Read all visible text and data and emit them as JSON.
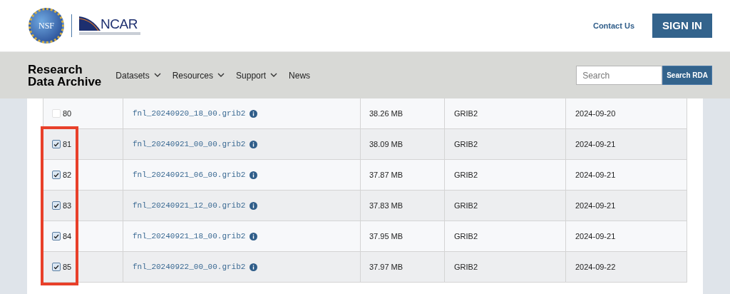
{
  "header": {
    "logos": {
      "nsf": "NSF",
      "ncar": "NCAR"
    },
    "contact": "Contact Us",
    "sign_in": "SIGN IN"
  },
  "nav": {
    "title_lines": [
      "Research",
      "Data Archive"
    ],
    "items": [
      {
        "label": "Datasets",
        "dropdown": true
      },
      {
        "label": "Resources",
        "dropdown": true
      },
      {
        "label": "Support",
        "dropdown": true
      },
      {
        "label": "News",
        "dropdown": false
      }
    ],
    "search": {
      "placeholder": "Search",
      "button": "Search RDA"
    }
  },
  "table": {
    "rows": [
      {
        "index": "80",
        "checked": false,
        "highlighted": false,
        "file": "fnl_20240920_18_00.grib2",
        "size": "38.26 MB",
        "format": "GRIB2",
        "date": "2024-09-20"
      },
      {
        "index": "81",
        "checked": true,
        "highlighted": true,
        "file": "fnl_20240921_00_00.grib2",
        "size": "38.09 MB",
        "format": "GRIB2",
        "date": "2024-09-21"
      },
      {
        "index": "82",
        "checked": true,
        "highlighted": true,
        "file": "fnl_20240921_06_00.grib2",
        "size": "37.87 MB",
        "format": "GRIB2",
        "date": "2024-09-21"
      },
      {
        "index": "83",
        "checked": true,
        "highlighted": true,
        "file": "fnl_20240921_12_00.grib2",
        "size": "37.83 MB",
        "format": "GRIB2",
        "date": "2024-09-21"
      },
      {
        "index": "84",
        "checked": true,
        "highlighted": true,
        "file": "fnl_20240921_18_00.grib2",
        "size": "37.95 MB",
        "format": "GRIB2",
        "date": "2024-09-21"
      },
      {
        "index": "85",
        "checked": true,
        "highlighted": true,
        "file": "fnl_20240922_00_00.grib2",
        "size": "37.97 MB",
        "format": "GRIB2",
        "date": "2024-09-22"
      }
    ]
  }
}
